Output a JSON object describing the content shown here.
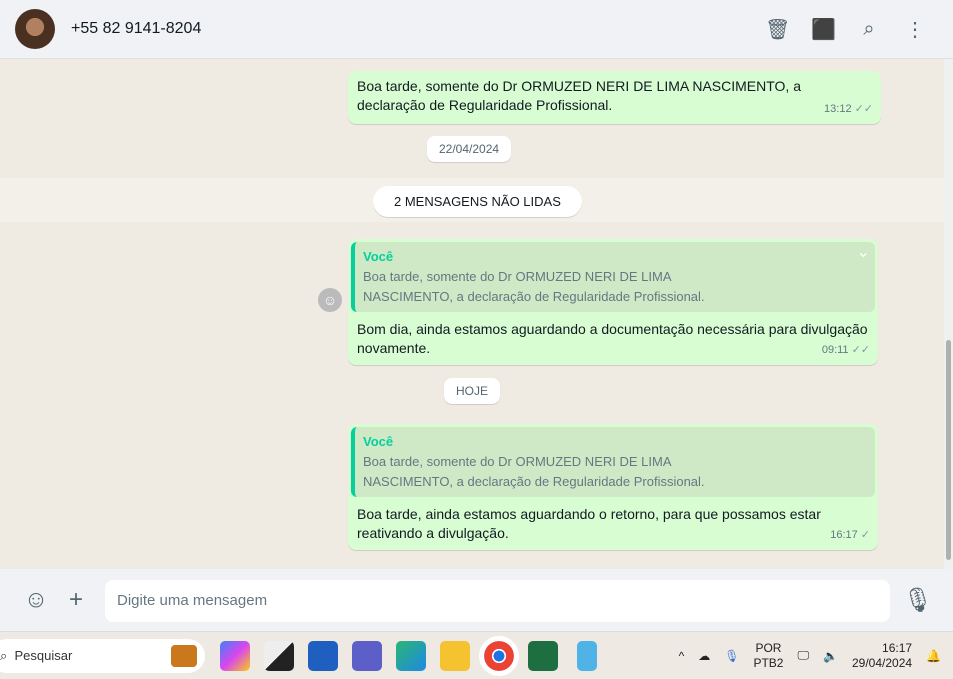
{
  "header": {
    "contact": "+55 82 9141-8204",
    "icons": [
      "archive-icon",
      "label-icon",
      "search-icon",
      "menu-icon"
    ]
  },
  "messages": [
    {
      "text": "Boa tarde, somente do Dr ORMUZED NERI DE LIMA NASCIMENTO, a declaração de Regularidade Profissional.",
      "time": "13:12"
    },
    {
      "quote_author": "Você",
      "quote_text": "Boa tarde, somente do Dr ORMUZED NERI DE LIMA NASCIMENTO, a declaração de Regularidade Profissional.",
      "text": "Bom dia, ainda estamos aguardando a documentação necessária para divulgação novamente.",
      "time": "09:11"
    },
    {
      "quote_author": "Você",
      "quote_text": "Boa tarde, somente do Dr ORMUZED NERI DE LIMA NASCIMENTO, a declaração de Regularidade Profissional.",
      "text": "Boa tarde, ainda estamos aguardando o retorno, para que possamos estar reativando a divulgação.",
      "time": "16:17"
    }
  ],
  "dates": {
    "d1": "22/04/2024",
    "today": "HOJE"
  },
  "unread": "2 MENSAGENS NÃO LIDAS",
  "composer": {
    "placeholder": "Digite uma mensagem"
  },
  "taskbar": {
    "search": "Pesquisar",
    "lang1": "POR",
    "lang2": "PTB2",
    "time": "16:17",
    "date": "29/04/2024"
  }
}
